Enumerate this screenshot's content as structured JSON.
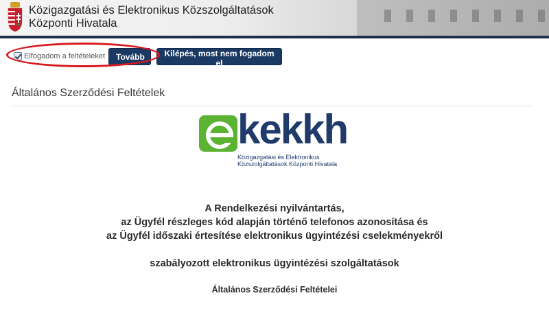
{
  "header": {
    "org_name_line1": "Közigazgatási és Elektronikus Közszolgáltatások",
    "org_name_line2": "Központi Hivatala"
  },
  "toolbar": {
    "accept_label": "Elfogadom a feltételeket",
    "accept_checked": true,
    "next_label": "Tovább",
    "exit_label": "Kilépés, most nem fogadom el"
  },
  "page": {
    "title": "Általános Szerződési Feltételek"
  },
  "logo": {
    "wordmark": "kekkh",
    "tagline_line1": "Közigazgatási és Elektronikus",
    "tagline_line2": "Közszolgáltatások Központi Hivatala"
  },
  "document": {
    "heading_lines": [
      "A Rendelkezési nyilvántartás,",
      "az Ügyfél részleges kód alapján történő telefonos azonosítása és",
      "az Ügyfél időszaki értesítése elektronikus ügyintézési cselekményekről"
    ],
    "service_line": "szabályozott elektronikus ügyintézési szolgáltatások",
    "subtitle": "Általános Szerződési Feltételei"
  },
  "colors": {
    "button_bg": "#1b3a63",
    "annotation_ring": "#d7191e",
    "logo_green": "#5ab331",
    "logo_navy": "#1f3a6b"
  }
}
